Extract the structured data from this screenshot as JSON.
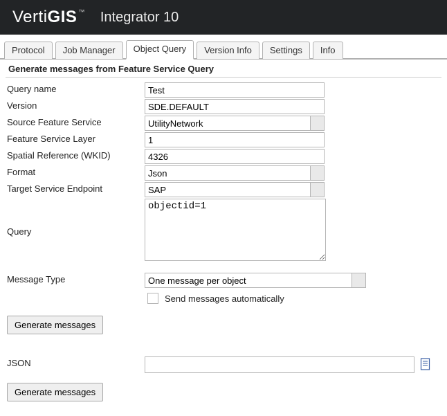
{
  "header": {
    "logo_prefix": "Verti",
    "logo_suffix": "GIS",
    "tm": "™",
    "product": "Integrator 10"
  },
  "tabs": [
    {
      "id": "protocol",
      "label": "Protocol",
      "active": false
    },
    {
      "id": "job-manager",
      "label": "Job Manager",
      "active": false
    },
    {
      "id": "object-query",
      "label": "Object Query",
      "active": true
    },
    {
      "id": "version-info",
      "label": "Version Info",
      "active": false
    },
    {
      "id": "settings",
      "label": "Settings",
      "active": false
    },
    {
      "id": "info",
      "label": "Info",
      "active": false
    }
  ],
  "panel": {
    "title": "Generate messages from Feature Service Query"
  },
  "form": {
    "query_name": {
      "label": "Query name",
      "value": "Test"
    },
    "version": {
      "label": "Version",
      "value": "SDE.DEFAULT"
    },
    "source_fs": {
      "label": "Source Feature Service",
      "value": "UtilityNetwork"
    },
    "fs_layer": {
      "label": "Feature Service Layer",
      "value": "1"
    },
    "wkid": {
      "label": "Spatial Reference (WKID)",
      "value": "4326"
    },
    "format": {
      "label": "Format",
      "value": "Json"
    },
    "target_ep": {
      "label": "Target Service Endpoint",
      "value": "SAP"
    },
    "query": {
      "label": "Query",
      "value": "objectid=1"
    },
    "msg_type": {
      "label": "Message Type",
      "value": "One message per object"
    },
    "auto_send": {
      "label": "Send messages automatically",
      "checked": false
    },
    "json": {
      "label": "JSON",
      "value": ""
    }
  },
  "buttons": {
    "generate1": "Generate messages",
    "generate2": "Generate messages"
  }
}
